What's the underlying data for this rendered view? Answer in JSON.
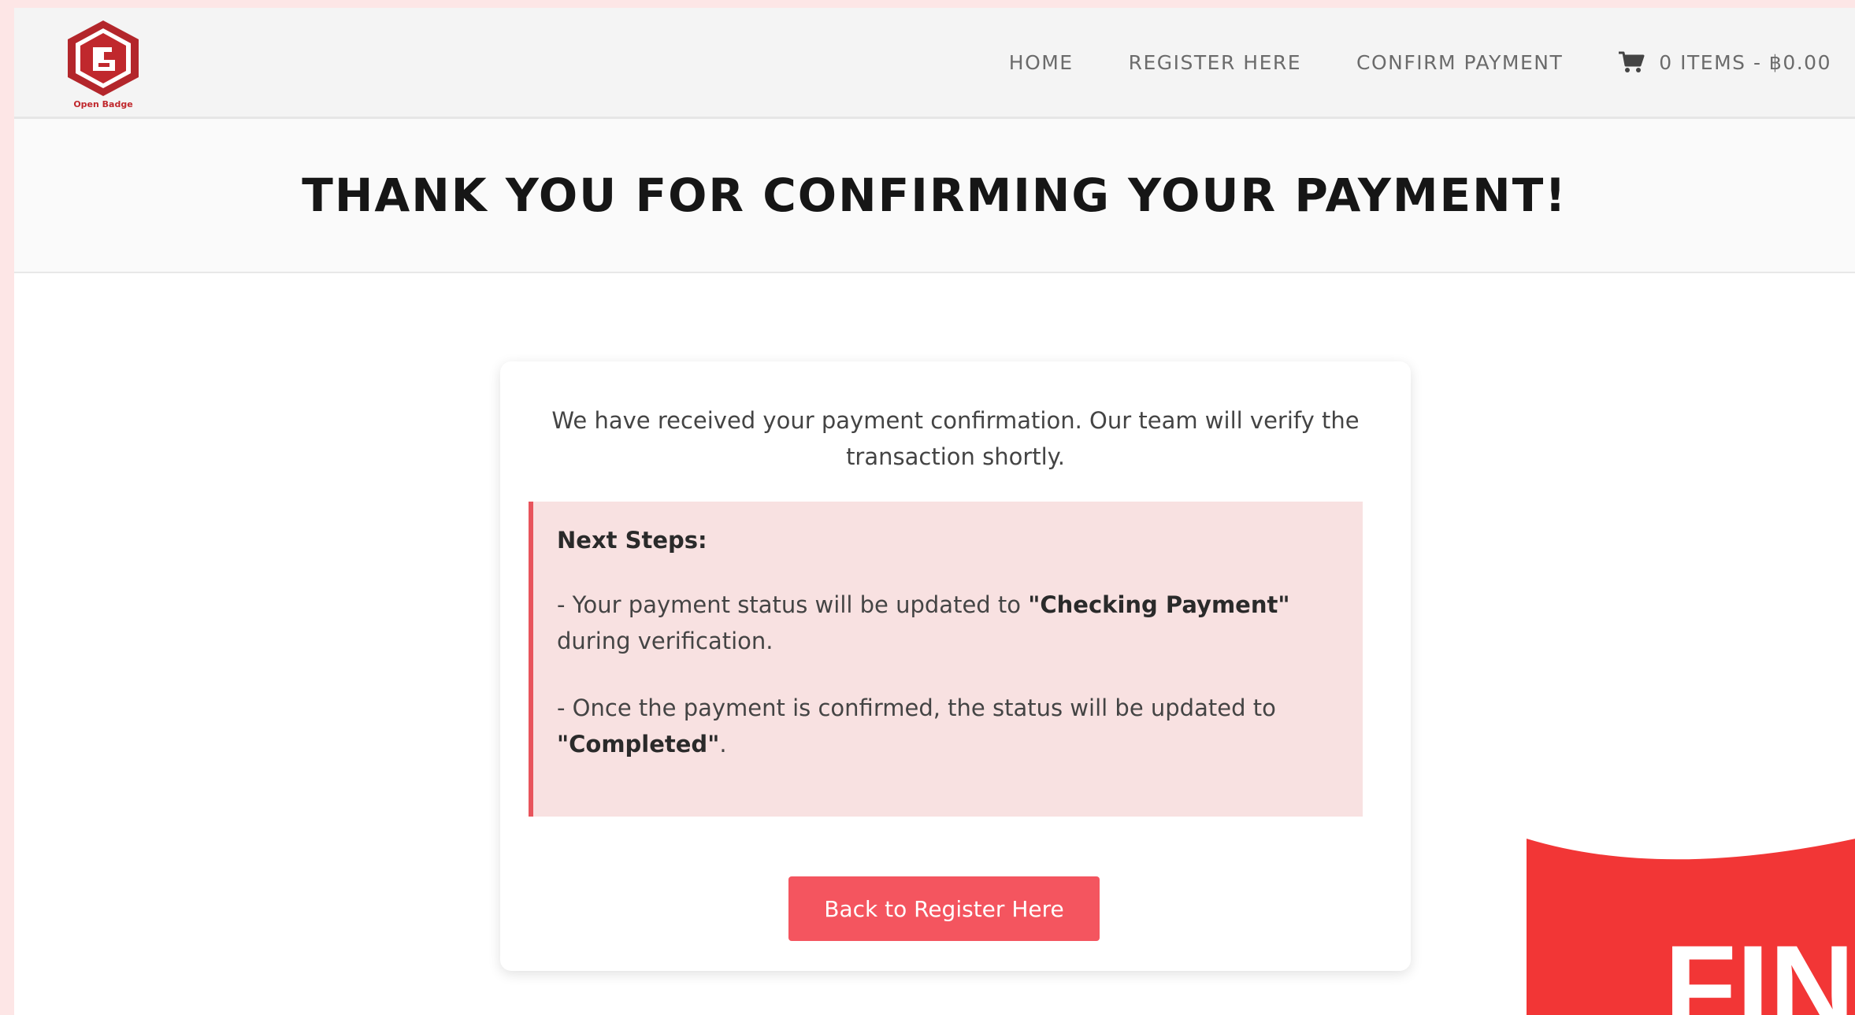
{
  "brand": {
    "logo_text": "Open Badge"
  },
  "nav": {
    "items": [
      "HOME",
      "REGISTER HERE",
      "CONFIRM PAYMENT"
    ],
    "cart_label": "0 ITEMS - ฿0.00"
  },
  "page": {
    "title": "THANK YOU FOR CONFIRMING YOUR PAYMENT!"
  },
  "card": {
    "intro": "We have received your payment confirmation. Our team will verify the transaction shortly.",
    "next_steps_heading": "Next Steps:",
    "step1_prefix": "- Your payment status will be updated to ",
    "step1_status": "\"Checking Payment\"",
    "step1_suffix": " during verification.",
    "step2_prefix": "- Once the payment is confirmed, the status will be updated to ",
    "step2_status": "\"Completed\"",
    "step2_suffix": ".",
    "button_label": "Back to Register Here"
  },
  "sticker": {
    "text": "FIN"
  },
  "colors": {
    "accent": "#f4555f",
    "brand_red": "#c0282d",
    "note_bg": "#f8e1e1"
  }
}
